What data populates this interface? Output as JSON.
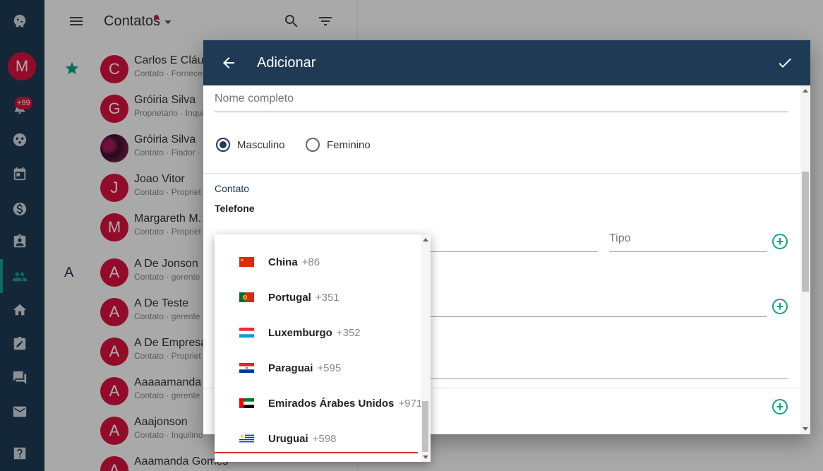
{
  "app": {
    "section_title": "Contatos",
    "user_initial": "M",
    "notification_badge": "+99"
  },
  "contacts": [
    {
      "initial": "C",
      "name": "Carlos E Cláuc",
      "sub": "Contato · Forneced"
    },
    {
      "initial": "G",
      "name": "Gróiria Silva",
      "sub": "Proprietário · Inquil"
    },
    {
      "initial": "",
      "name": "Gróiria Silva",
      "sub": "Contato · Fiador · F"
    },
    {
      "initial": "J",
      "name": "Joao Vitor",
      "sub": "Contato · Propriet"
    },
    {
      "initial": "M",
      "name": "Margareth M.",
      "sub": "Contato · Propriet"
    },
    {
      "initial": "A",
      "name": "A De Jonson",
      "sub": "Contato · gerente ·"
    },
    {
      "initial": "A",
      "name": "A De Teste",
      "sub": "Contato · gerente ·"
    },
    {
      "initial": "A",
      "name": "A De Empresa",
      "sub": "Contato · Propriet"
    },
    {
      "initial": "A",
      "name": "Aaaaamanda",
      "sub": "Contato · gerente ·"
    },
    {
      "initial": "A",
      "name": "Aaajonson",
      "sub": "Contato · Inquilino"
    },
    {
      "initial": "A",
      "name": "Aaamanda Gomes",
      "sub": ""
    }
  ],
  "group_letter": "A",
  "dialog": {
    "title": "Adicionar",
    "full_name_placeholder": "Nome completo",
    "gender_male": "Masculino",
    "gender_female": "Feminino",
    "contact_section": "Contato",
    "phone_label": "Telefone",
    "type_placeholder": "Tipo"
  },
  "dropdown": {
    "items": [
      {
        "name": "China",
        "code": "+86",
        "flag": "cn"
      },
      {
        "name": "Portugal",
        "code": "+351",
        "flag": "pt"
      },
      {
        "name": "Luxemburgo",
        "code": "+352",
        "flag": "lu"
      },
      {
        "name": "Paraguai",
        "code": "+595",
        "flag": "py"
      },
      {
        "name": "Emirados Árabes Unidos",
        "code": "+971",
        "flag": "ae"
      },
      {
        "name": "Uruguai",
        "code": "+598",
        "flag": "uy"
      }
    ]
  },
  "colors": {
    "primary": "#1e3a55",
    "accent": "#12a08a",
    "avatar": "#d8123f"
  }
}
